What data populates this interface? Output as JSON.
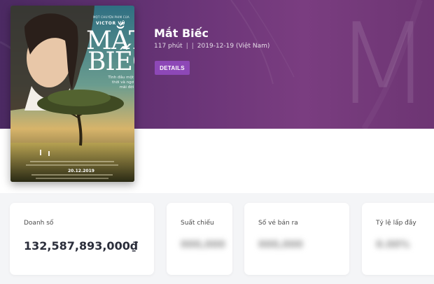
{
  "movie": {
    "title": "Mắt Biếc",
    "runtime": "117 phút",
    "separator1": "|",
    "separator2": "|",
    "release": "2019-12-19 (Việt Nam)",
    "details_button": "DETAILS",
    "background_letter": "M"
  },
  "poster": {
    "top_line": "MỘT CHUYỆN PHIM CỦA",
    "director": "VICTOR VŨ",
    "title_line1": "MẮT",
    "title_line2": "BIẾC",
    "tagline": "Tình đầu một thời và ngơ mãi đời",
    "date": "20.12.2019"
  },
  "stats": [
    {
      "label": "Doanh số",
      "value": "132,587,893,000₫"
    },
    {
      "label": "Suất chiếu",
      "value": "000,000"
    },
    {
      "label": "Số vé bán ra",
      "value": "000,000"
    },
    {
      "label": "Tỷ lệ lấp đầy",
      "value": "0.00%"
    }
  ],
  "colors": {
    "hero": "#6b3578",
    "button": "#8d48b7",
    "value_text": "#2b2e3b"
  }
}
